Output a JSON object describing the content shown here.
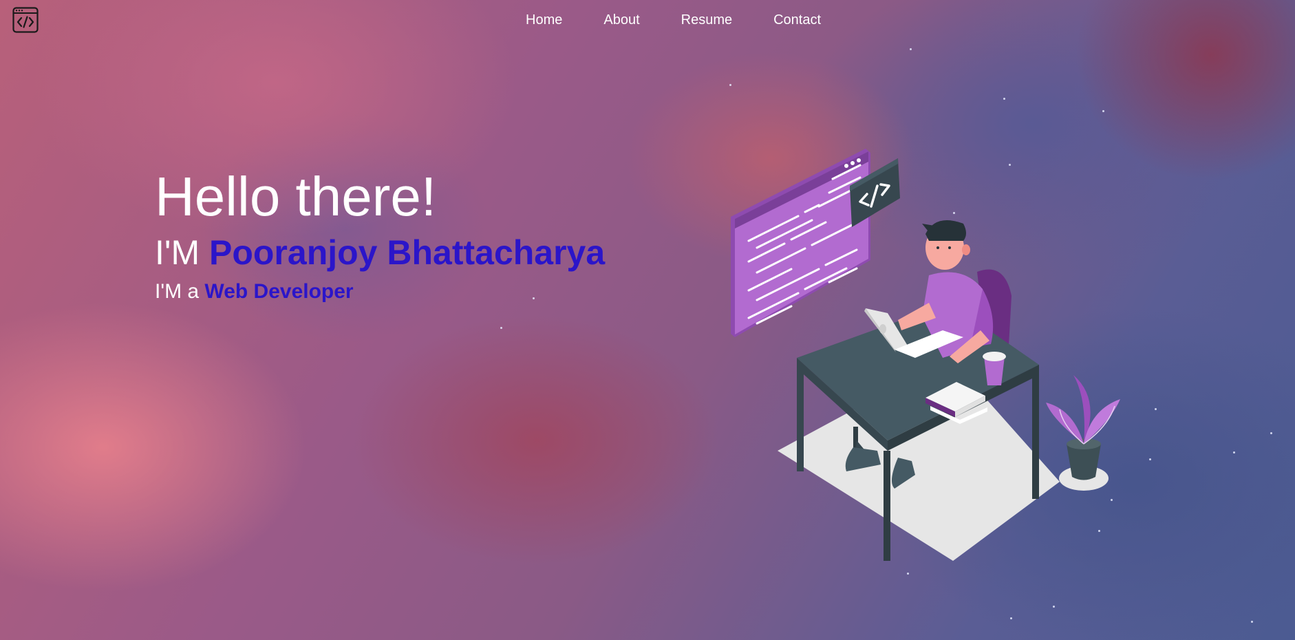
{
  "nav": {
    "logo_icon": "code-window-icon",
    "items": [
      "Home",
      "About",
      "Resume",
      "Contact"
    ]
  },
  "hero": {
    "greeting": "Hello there!",
    "name_prefix": "I'M",
    "name": "Pooranjoy Bhattacharya",
    "role_prefix": "I'M a",
    "role": "Web Developer"
  },
  "illustration": {
    "icon": "developer-at-desk-illustration",
    "code_badge": "</>"
  },
  "colors": {
    "accent": "#2b15c9",
    "nav_text": "#ffffff",
    "screen_purple": "#b26bd0",
    "desk": "#455a64"
  }
}
